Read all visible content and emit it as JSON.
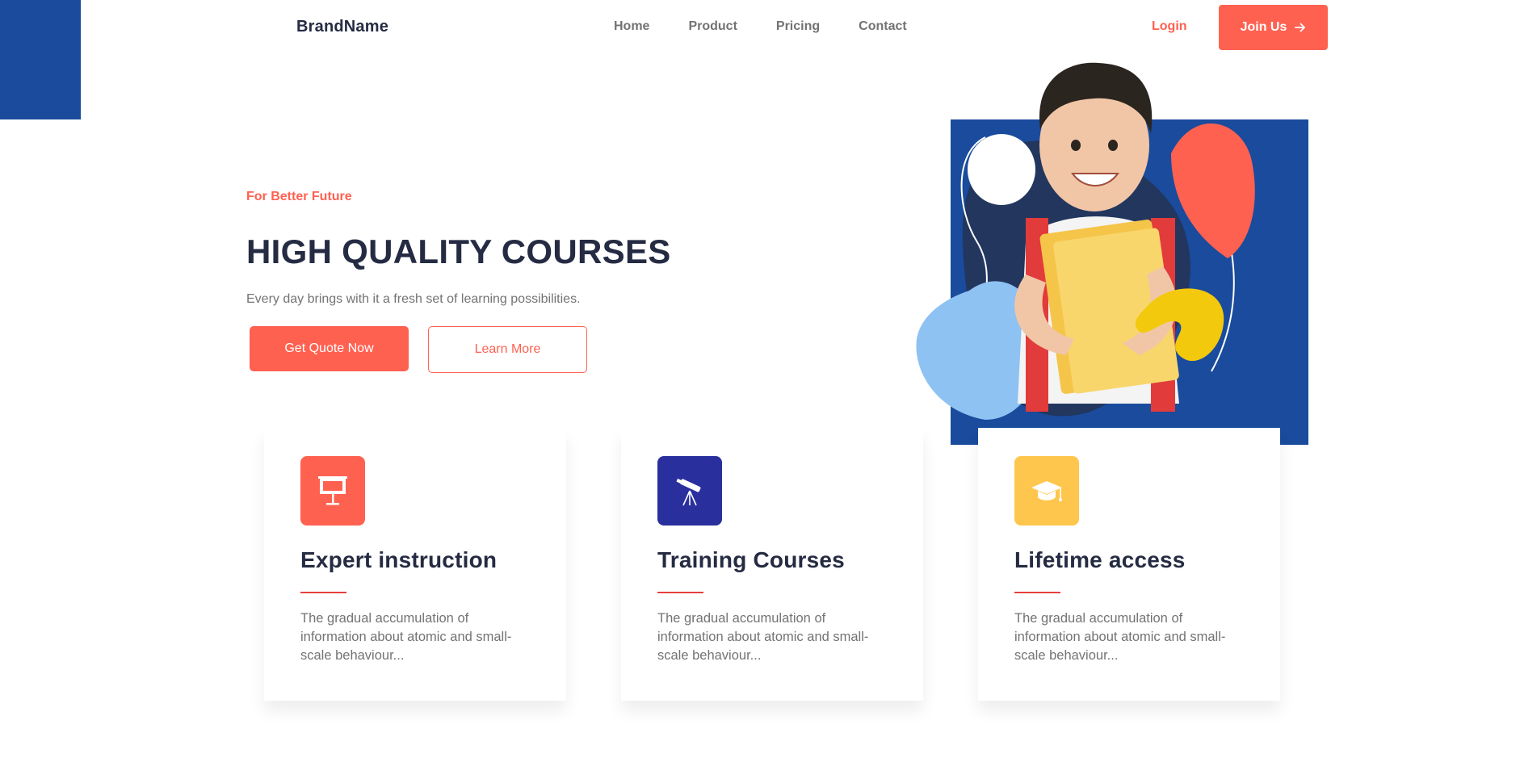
{
  "header": {
    "brand": "BrandName",
    "nav_items": [
      {
        "label": "Home"
      },
      {
        "label": "Product"
      },
      {
        "label": "Pricing"
      },
      {
        "label": "Contact"
      }
    ],
    "login_label": "Login",
    "join_label": "Join Us",
    "join_icon": "arrow-right-icon"
  },
  "hero": {
    "tagline": "For Better Future",
    "title": "HIGH QUALITY COURSES",
    "subtitle": "Every day brings with it a fresh set of learning possibilities.",
    "primary_button": "Get Quote Now",
    "secondary_button": "Learn More",
    "image": "child-with-books-image"
  },
  "features": [
    {
      "icon": "presentation-board-icon",
      "icon_bg": "#FF6151",
      "title": "Expert instruction",
      "text": "The gradual accumulation of information about atomic and small-scale behaviour..."
    },
    {
      "icon": "telescope-icon",
      "icon_bg": "#2A2F9E",
      "title": "Training Courses",
      "text": "The gradual accumulation of information about atomic and small-scale behaviour..."
    },
    {
      "icon": "graduation-cap-icon",
      "icon_bg": "#FFC64D",
      "title": "Lifetime access",
      "text": "The gradual accumulation of information about atomic and small-scale behaviour..."
    }
  ],
  "colors": {
    "accent": "#FF6151",
    "blue": "#1A4B9C",
    "heading": "#252B42",
    "muted": "#737373"
  }
}
